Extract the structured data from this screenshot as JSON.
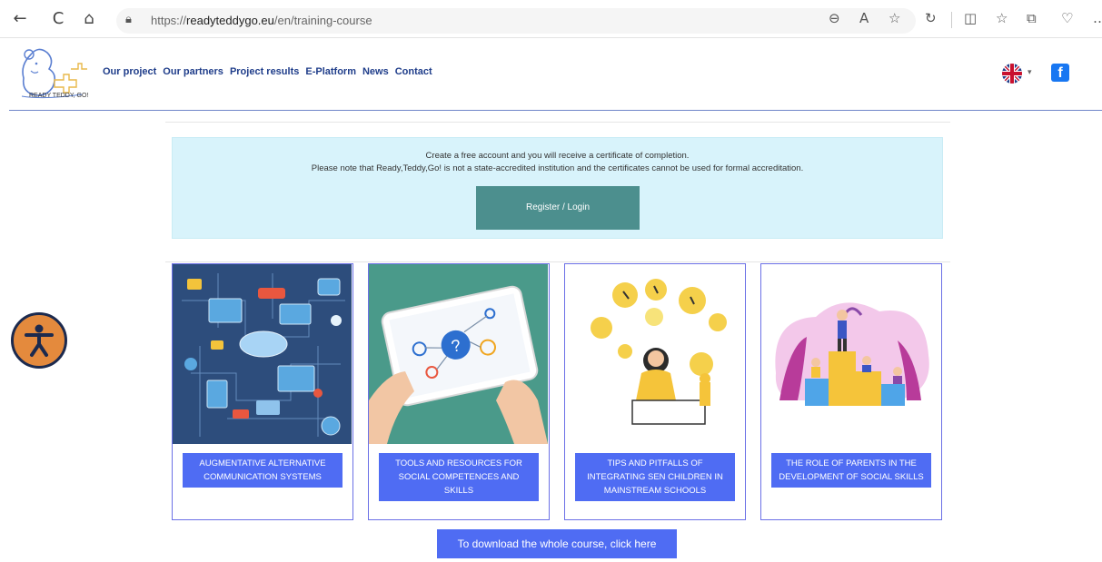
{
  "browser": {
    "url_prefix": "https://",
    "url_host": "readyteddygo.eu",
    "url_path": "/en/training-course",
    "back_icon": "←",
    "refresh_icon": "C",
    "home_icon": "⌂",
    "lock_icon": "🔒︎"
  },
  "header": {
    "logo_text": "READY TEDDY, GO!",
    "nav": [
      "Our project",
      "Our partners",
      "Project results",
      "E-Platform",
      "News",
      "Contact"
    ],
    "facebook_letter": "f"
  },
  "info": {
    "line1": "Create a free account and you will receive a certificate of completion.",
    "line2": "Please note that Ready,Teddy,Go! is not a state-accredited institution and the certificates cannot be used for formal accreditation.",
    "register_label": "Register / Login"
  },
  "cards": [
    {
      "title": "AUGMENTATIVE ALTERNATIVE COMMUNICATION SYSTEMS"
    },
    {
      "title": "TOOLS AND RESOURCES FOR SOCIAL COMPETENCES AND SKILLS"
    },
    {
      "title": "TIPS AND PITFALLS OF INTEGRATING SEN CHILDREN IN MAINSTREAM SCHOOLS"
    },
    {
      "title": "THE ROLE OF PARENTS IN THE DEVELOPMENT OF SOCIAL SKILLS"
    }
  ],
  "download_label": "To download the whole course, click here",
  "colors": {
    "info_bg": "#d8f3fb",
    "register_btn": "#4c8f8e",
    "card_btn": "#4f6cf3",
    "card_border": "#6b70e6",
    "nav_text": "#1f3d8a",
    "accessibility": "#e48a3d"
  }
}
